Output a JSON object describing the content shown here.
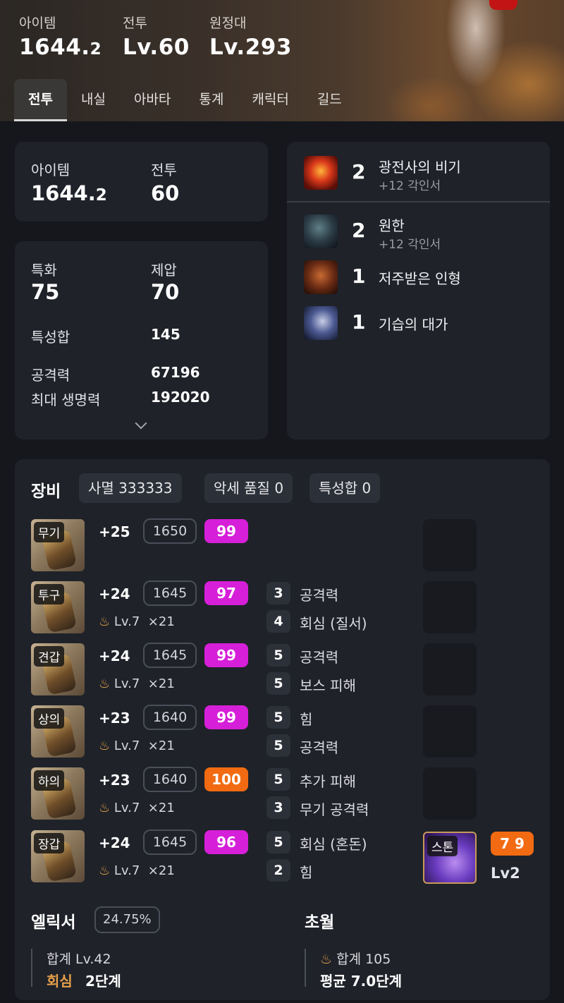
{
  "header": {
    "stats": [
      {
        "label": "아이템",
        "value_main": "1644.",
        "value_small": "2"
      },
      {
        "label": "전투",
        "value_main": "Lv.60",
        "value_small": ""
      },
      {
        "label": "원정대",
        "value_main": "Lv.293",
        "value_small": ""
      }
    ],
    "tabs": [
      "전투",
      "내실",
      "아바타",
      "통계",
      "캐릭터",
      "길드"
    ],
    "active_tab": "전투"
  },
  "summary": {
    "item_label": "아이템",
    "item_main": "1644.",
    "item_small": "2",
    "combat_label": "전투",
    "combat_value": "60"
  },
  "stats_card": {
    "crit_label": "특화",
    "crit_value": "75",
    "dom_label": "제압",
    "dom_value": "70",
    "sum_label": "특성합",
    "sum_value": "145",
    "atk_label": "공격력",
    "atk_value": "67196",
    "hp_label": "최대 생명력",
    "hp_value": "192020"
  },
  "engravings": [
    {
      "level": "2",
      "name": "광전사의 비기",
      "sub": "+12 각인서",
      "icon": "berserker-icon"
    },
    {
      "level": "2",
      "name": "원한",
      "sub": "+12 각인서",
      "icon": "grudge-icon"
    },
    {
      "level": "1",
      "name": "저주받은 인형",
      "sub": "",
      "icon": "cursed-doll-icon"
    },
    {
      "level": "1",
      "name": "기습의 대가",
      "sub": "",
      "icon": "master-ambush-icon"
    }
  ],
  "equipment": {
    "title": "장비",
    "badges": [
      "사멸 333333",
      "악세 품질 0",
      "특성합 0"
    ],
    "items": [
      {
        "slot": "무기",
        "honing": "+25",
        "ilvl": "1650",
        "quality": "99",
        "quality_color": "#d61fd8",
        "trans": "",
        "trans_count": "",
        "ench": []
      },
      {
        "slot": "투구",
        "honing": "+24",
        "ilvl": "1645",
        "quality": "97",
        "quality_color": "#d61fd8",
        "trans": "Lv.7",
        "trans_count": "×21",
        "ench": [
          {
            "n": "3",
            "t": "공격력"
          },
          {
            "n": "4",
            "t": "회심 (질서)"
          }
        ]
      },
      {
        "slot": "견갑",
        "honing": "+24",
        "ilvl": "1645",
        "quality": "99",
        "quality_color": "#d61fd8",
        "trans": "Lv.7",
        "trans_count": "×21",
        "ench": [
          {
            "n": "5",
            "t": "공격력"
          },
          {
            "n": "5",
            "t": "보스 피해"
          }
        ]
      },
      {
        "slot": "상의",
        "honing": "+23",
        "ilvl": "1640",
        "quality": "99",
        "quality_color": "#d61fd8",
        "trans": "Lv.7",
        "trans_count": "×21",
        "ench": [
          {
            "n": "5",
            "t": "힘"
          },
          {
            "n": "5",
            "t": "공격력"
          }
        ]
      },
      {
        "slot": "하의",
        "honing": "+23",
        "ilvl": "1640",
        "quality": "100",
        "quality_color": "#f26b12",
        "trans": "Lv.7",
        "trans_count": "×21",
        "ench": [
          {
            "n": "5",
            "t": "추가 피해"
          },
          {
            "n": "3",
            "t": "무기 공격력"
          }
        ]
      },
      {
        "slot": "장갑",
        "honing": "+24",
        "ilvl": "1645",
        "quality": "96",
        "quality_color": "#d61fd8",
        "trans": "Lv.7",
        "trans_count": "×21",
        "ench": [
          {
            "n": "5",
            "t": "회심 (혼돈)"
          },
          {
            "n": "2",
            "t": "힘"
          }
        ]
      }
    ],
    "stone": {
      "label": "스톤",
      "value": "7 9",
      "level": "Lv2"
    }
  },
  "elixir": {
    "title": "엘릭서",
    "percent": "24.75%",
    "total": "합계 Lv.42",
    "effect_name": "회심",
    "effect_level": "2단계"
  },
  "transcend": {
    "title": "초월",
    "total": "합계 105",
    "avg": "평균 7.0단계"
  }
}
